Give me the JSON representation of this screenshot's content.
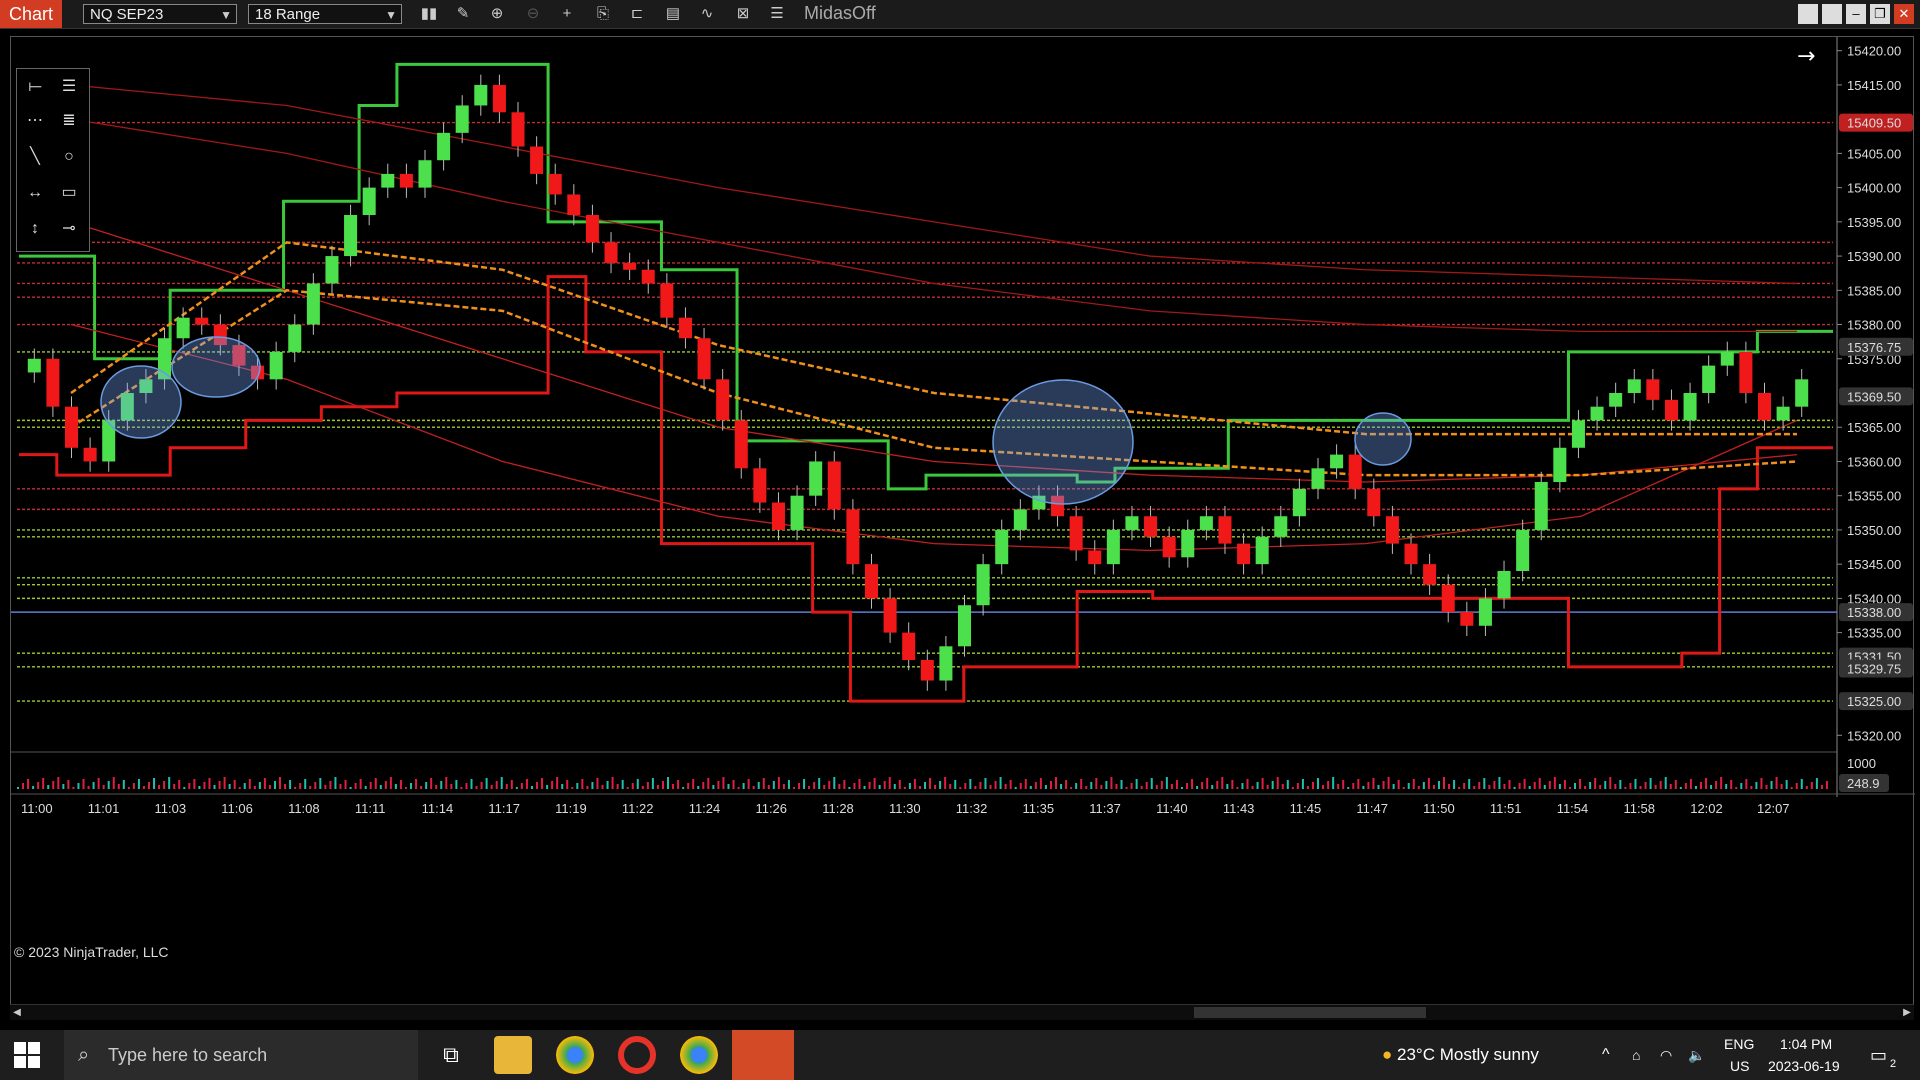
{
  "toolbar": {
    "chart_tab": "Chart",
    "instrument": "NQ SEP23",
    "bar_type": "18 Range",
    "indicator_label": "MidasOff",
    "icons": [
      "bars-type-icon",
      "draw-tool-icon",
      "zoom-in-icon",
      "zoom-out-icon",
      "crosshair-icon",
      "properties-icon",
      "templates-icon",
      "indicators-icon",
      "strategies-icon",
      "data-box-icon",
      "chart-trader-icon"
    ]
  },
  "window_controls": [
    "tile-icon",
    "tile-icon",
    "minimize-icon",
    "restore-icon",
    "close-icon"
  ],
  "drawing_tools": [
    "line-icon",
    "horizontal-lines-icon",
    "ray-icon",
    "fib-icon",
    "diagonal-line-icon",
    "ellipse-icon",
    "extended-line-icon",
    "rectangle-icon",
    "vertical-line-icon",
    "marker-icon"
  ],
  "chart_data": {
    "type": "candlestick",
    "instrument": "NQ SEP23",
    "y_ticks": [
      "15420.00",
      "15415.00",
      "15405.00",
      "15400.00",
      "15395.00",
      "15390.00",
      "15385.00",
      "15380.00",
      "15375.00",
      "15365.00",
      "15360.00",
      "15355.00",
      "15350.00",
      "15345.00",
      "15340.00",
      "15335.00",
      "15320.00"
    ],
    "price_tags": [
      {
        "label": "15409.50",
        "color": "#c02020"
      },
      {
        "label": "15376.75",
        "color": "#333333"
      },
      {
        "label": "15369.50",
        "color": "#333333"
      },
      {
        "label": "15338.00",
        "color": "#333333"
      },
      {
        "label": "15331.50",
        "color": "#333333"
      },
      {
        "label": "15329.75",
        "color": "#333333"
      },
      {
        "label": "15325.00",
        "color": "#333333"
      }
    ],
    "x_ticks": [
      "11:00",
      "11:01",
      "11:03",
      "11:06",
      "11:08",
      "11:11",
      "11:14",
      "11:17",
      "11:19",
      "11:22",
      "11:24",
      "11:26",
      "11:28",
      "11:30",
      "11:32",
      "11:35",
      "11:37",
      "11:40",
      "11:43",
      "11:45",
      "11:47",
      "11:50",
      "11:51",
      "11:54",
      "11:58",
      "12:02",
      "12:07"
    ],
    "ylim": [
      15318,
      15422
    ],
    "horizontal_line": 15338.0,
    "close_series": [
      15375,
      15368,
      15362,
      15360,
      15366,
      15370,
      15372,
      15378,
      15381,
      15380,
      15377,
      15374,
      15372,
      15376,
      15380,
      15386,
      15390,
      15396,
      15400,
      15402,
      15400,
      15404,
      15408,
      15412,
      15415,
      15411,
      15406,
      15402,
      15399,
      15396,
      15392,
      15389,
      15388,
      15386,
      15381,
      15378,
      15372,
      15366,
      15359,
      15354,
      15350,
      15355,
      15360,
      15353,
      15345,
      15340,
      15335,
      15331,
      15328,
      15333,
      15339,
      15345,
      15350,
      15353,
      15355,
      15352,
      15347,
      15345,
      15350,
      15352,
      15349,
      15346,
      15350,
      15352,
      15348,
      15345,
      15349,
      15352,
      15356,
      15359,
      15361,
      15356,
      15352,
      15348,
      15345,
      15342,
      15338,
      15336,
      15340,
      15344,
      15350,
      15357,
      15362,
      15366,
      15368,
      15370,
      15372,
      15369,
      15366,
      15370,
      15374,
      15376,
      15370,
      15366,
      15368,
      15372
    ],
    "volume_scale": [
      "1000",
      "248.9"
    ],
    "green_step": [
      15390,
      15390,
      15375,
      15375,
      15385,
      15385,
      15385,
      15398,
      15398,
      15412,
      15418,
      15418,
      15418,
      15418,
      15395,
      15395,
      15395,
      15388,
      15388,
      15363,
      15363,
      15363,
      15363,
      15356,
      15358,
      15358,
      15358,
      15358,
      15357,
      15359,
      15359,
      15359,
      15366,
      15366,
      15366,
      15366,
      15366,
      15366,
      15366,
      15366,
      15366,
      15376,
      15376,
      15376,
      15376,
      15376,
      15379,
      15379
    ],
    "red_step": [
      15361,
      15358,
      15358,
      15358,
      15362,
      15362,
      15366,
      15366,
      15368,
      15368,
      15370,
      15370,
      15370,
      15370,
      15387,
      15376,
      15376,
      15348,
      15348,
      15348,
      15348,
      15338,
      15325,
      15325,
      15325,
      15330,
      15330,
      15330,
      15341,
      15341,
      15340,
      15340,
      15340,
      15340,
      15340,
      15340,
      15340,
      15340,
      15340,
      15340,
      15340,
      15330,
      15330,
      15330,
      15332,
      15356,
      15362,
      15362
    ]
  },
  "copyright": "© 2023 NinjaTrader, LLC",
  "taskbar": {
    "search_placeholder": "Type here to search",
    "weather": "23°C  Mostly sunny",
    "lang_top": "ENG",
    "lang_bottom": "US",
    "time": "1:04 PM",
    "date": "2023-06-19",
    "notification_count": "2",
    "apps": [
      "task-view-icon",
      "file-explorer-icon",
      "chrome-icon",
      "opera-icon",
      "chrome-profile-icon",
      "ninjatrader-icon"
    ]
  }
}
